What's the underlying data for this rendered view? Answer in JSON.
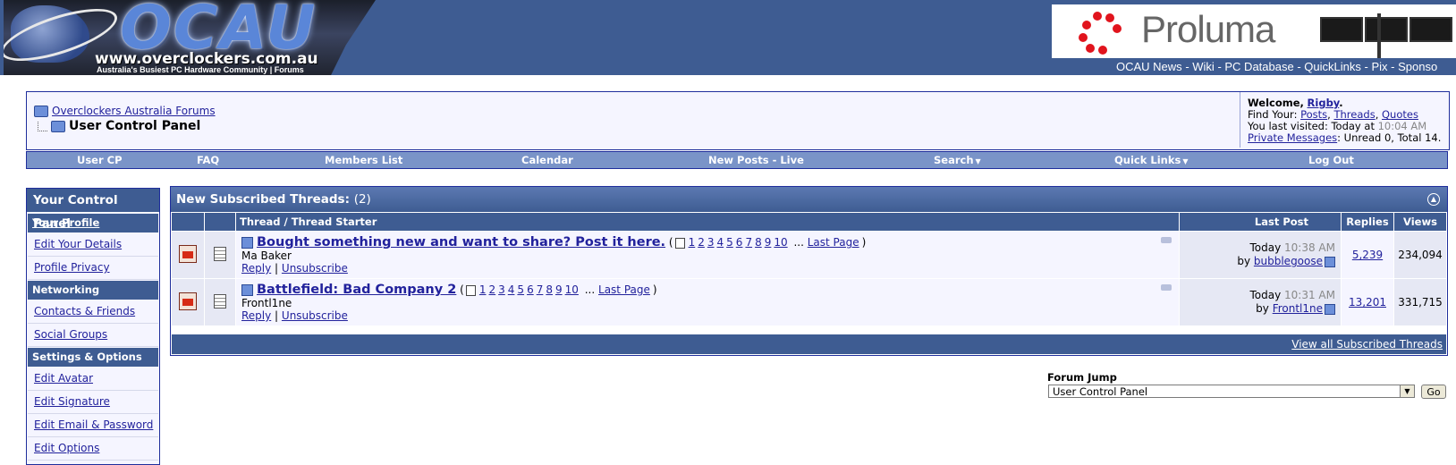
{
  "header": {
    "logo_title": "OCAU",
    "logo_url": "www.overclockers.com.au",
    "logo_tagline": "Australia's Busiest PC Hardware Community | Forums",
    "banner_brand": "Proluma",
    "links": [
      "OCAU News",
      "Wiki",
      "PC Database",
      "QuickLinks",
      "Pix",
      "Sponso"
    ]
  },
  "breadcrumb": {
    "root": "Overclockers Australia Forums",
    "current": "User Control Panel"
  },
  "welcome": {
    "welcome_label": "Welcome,",
    "username": "Rigby",
    "find_label": "Find Your:",
    "find_posts": "Posts",
    "find_threads": "Threads",
    "find_quotes": "Quotes",
    "last_visited_label": "You last visited: Today at",
    "last_visited_time": "10:04 AM",
    "pm_label": "Private Messages",
    "pm_stats": ": Unread 0, Total 14."
  },
  "menu": {
    "items": [
      "User CP",
      "FAQ",
      "Members List",
      "Calendar",
      "New Posts - Live",
      "Search",
      "Quick Links",
      "Log Out"
    ]
  },
  "control_panel": {
    "title": "Your Control Panel",
    "your_profile": "Your Profile",
    "profile_links": [
      "Edit Your Details",
      "Profile Privacy"
    ],
    "networking_title": "Networking",
    "networking_links": [
      "Contacts & Friends",
      "Social Groups"
    ],
    "settings_title": "Settings & Options",
    "settings_links": [
      "Edit Avatar",
      "Edit Signature",
      "Edit Email & Password",
      "Edit Options"
    ]
  },
  "subscriptions": {
    "title": "New Subscribed Threads:",
    "count": "(2)",
    "columns": {
      "thread": "Thread / Thread Starter",
      "last_post": "Last Post",
      "replies": "Replies",
      "views": "Views"
    },
    "threads": [
      {
        "title": "Bought something new and want to share? Post it here.",
        "pages": [
          "1",
          "2",
          "3",
          "4",
          "5",
          "6",
          "7",
          "8",
          "9",
          "10"
        ],
        "ellipsis": "...",
        "last_page": "Last Page",
        "starter": "Ma Baker",
        "reply": "Reply",
        "unsubscribe": "Unsubscribe",
        "last_day": "Today",
        "last_time": "10:38 AM",
        "by_label": "by",
        "last_user": "bubblegoose",
        "replies": "5,239",
        "views": "234,094"
      },
      {
        "title": "Battlefield: Bad Company 2",
        "pages": [
          "1",
          "2",
          "3",
          "4",
          "5",
          "6",
          "7",
          "8",
          "9",
          "10"
        ],
        "ellipsis": "...",
        "last_page": "Last Page",
        "starter": "Frontl1ne",
        "reply": "Reply",
        "unsubscribe": "Unsubscribe",
        "last_day": "Today",
        "last_time": "10:31 AM",
        "by_label": "by",
        "last_user": "Frontl1ne",
        "replies": "13,201",
        "views": "331,715"
      }
    ],
    "view_all": "View all Subscribed Threads"
  },
  "forum_jump": {
    "label": "Forum Jump",
    "selected": "User Control Panel",
    "go": "Go"
  },
  "colors": {
    "header_bg": "#3e5c92",
    "link": "#22229c",
    "border": "#1f2e9c"
  }
}
